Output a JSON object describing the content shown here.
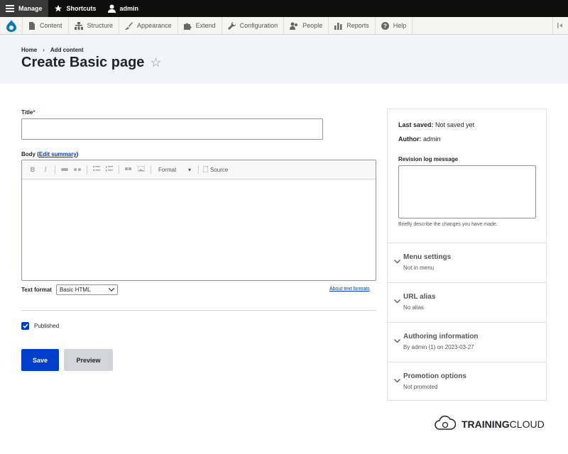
{
  "toolbar": {
    "manage": "Manage",
    "shortcuts": "Shortcuts",
    "user": "admin"
  },
  "admin_menu": {
    "items": [
      {
        "label": "Content",
        "icon": "page-icon"
      },
      {
        "label": "Structure",
        "icon": "sitemap-icon"
      },
      {
        "label": "Appearance",
        "icon": "brush-icon"
      },
      {
        "label": "Extend",
        "icon": "puzzle-icon"
      },
      {
        "label": "Configuration",
        "icon": "wrench-icon"
      },
      {
        "label": "People",
        "icon": "people-icon"
      },
      {
        "label": "Reports",
        "icon": "bars-icon"
      },
      {
        "label": "Help",
        "icon": "help-icon"
      }
    ]
  },
  "breadcrumb": {
    "home": "Home",
    "sep": "›",
    "current": "Add content"
  },
  "page": {
    "title": "Create Basic page",
    "star": "☆"
  },
  "form": {
    "title_label": "Title",
    "required_mark": "*",
    "body_label": "Body (",
    "body_link": "Edit summary",
    "body_close": ")",
    "editor": {
      "bold": "B",
      "italic": "I",
      "format": "Format",
      "format_caret": "▾",
      "source": "Source"
    },
    "text_format_label": "Text format",
    "text_format_value": "Basic HTML",
    "about_formats": "About text formats",
    "published_label": "Published",
    "save": "Save",
    "preview": "Preview"
  },
  "sidebar": {
    "last_saved_label": "Last saved:",
    "last_saved_value": "Not saved yet",
    "author_label": "Author:",
    "author_value": "admin",
    "revision_label": "Revision log message",
    "revision_desc": "Briefly describe the changes you have made.",
    "sections": [
      {
        "title": "Menu settings",
        "summary": "Not in menu"
      },
      {
        "title": "URL alias",
        "summary": "No alias"
      },
      {
        "title": "Authoring information",
        "summary": "By admin (1) on 2023-03-27"
      },
      {
        "title": "Promotion options",
        "summary": "Not promoted"
      }
    ]
  },
  "brand": {
    "bold": "TRAINING",
    "light": "CLOUD"
  },
  "colors": {
    "accent": "#003ecc",
    "toolbar_bg": "#0f0f0f",
    "header_bg": "#f3f4f9",
    "required": "#dc2323"
  }
}
